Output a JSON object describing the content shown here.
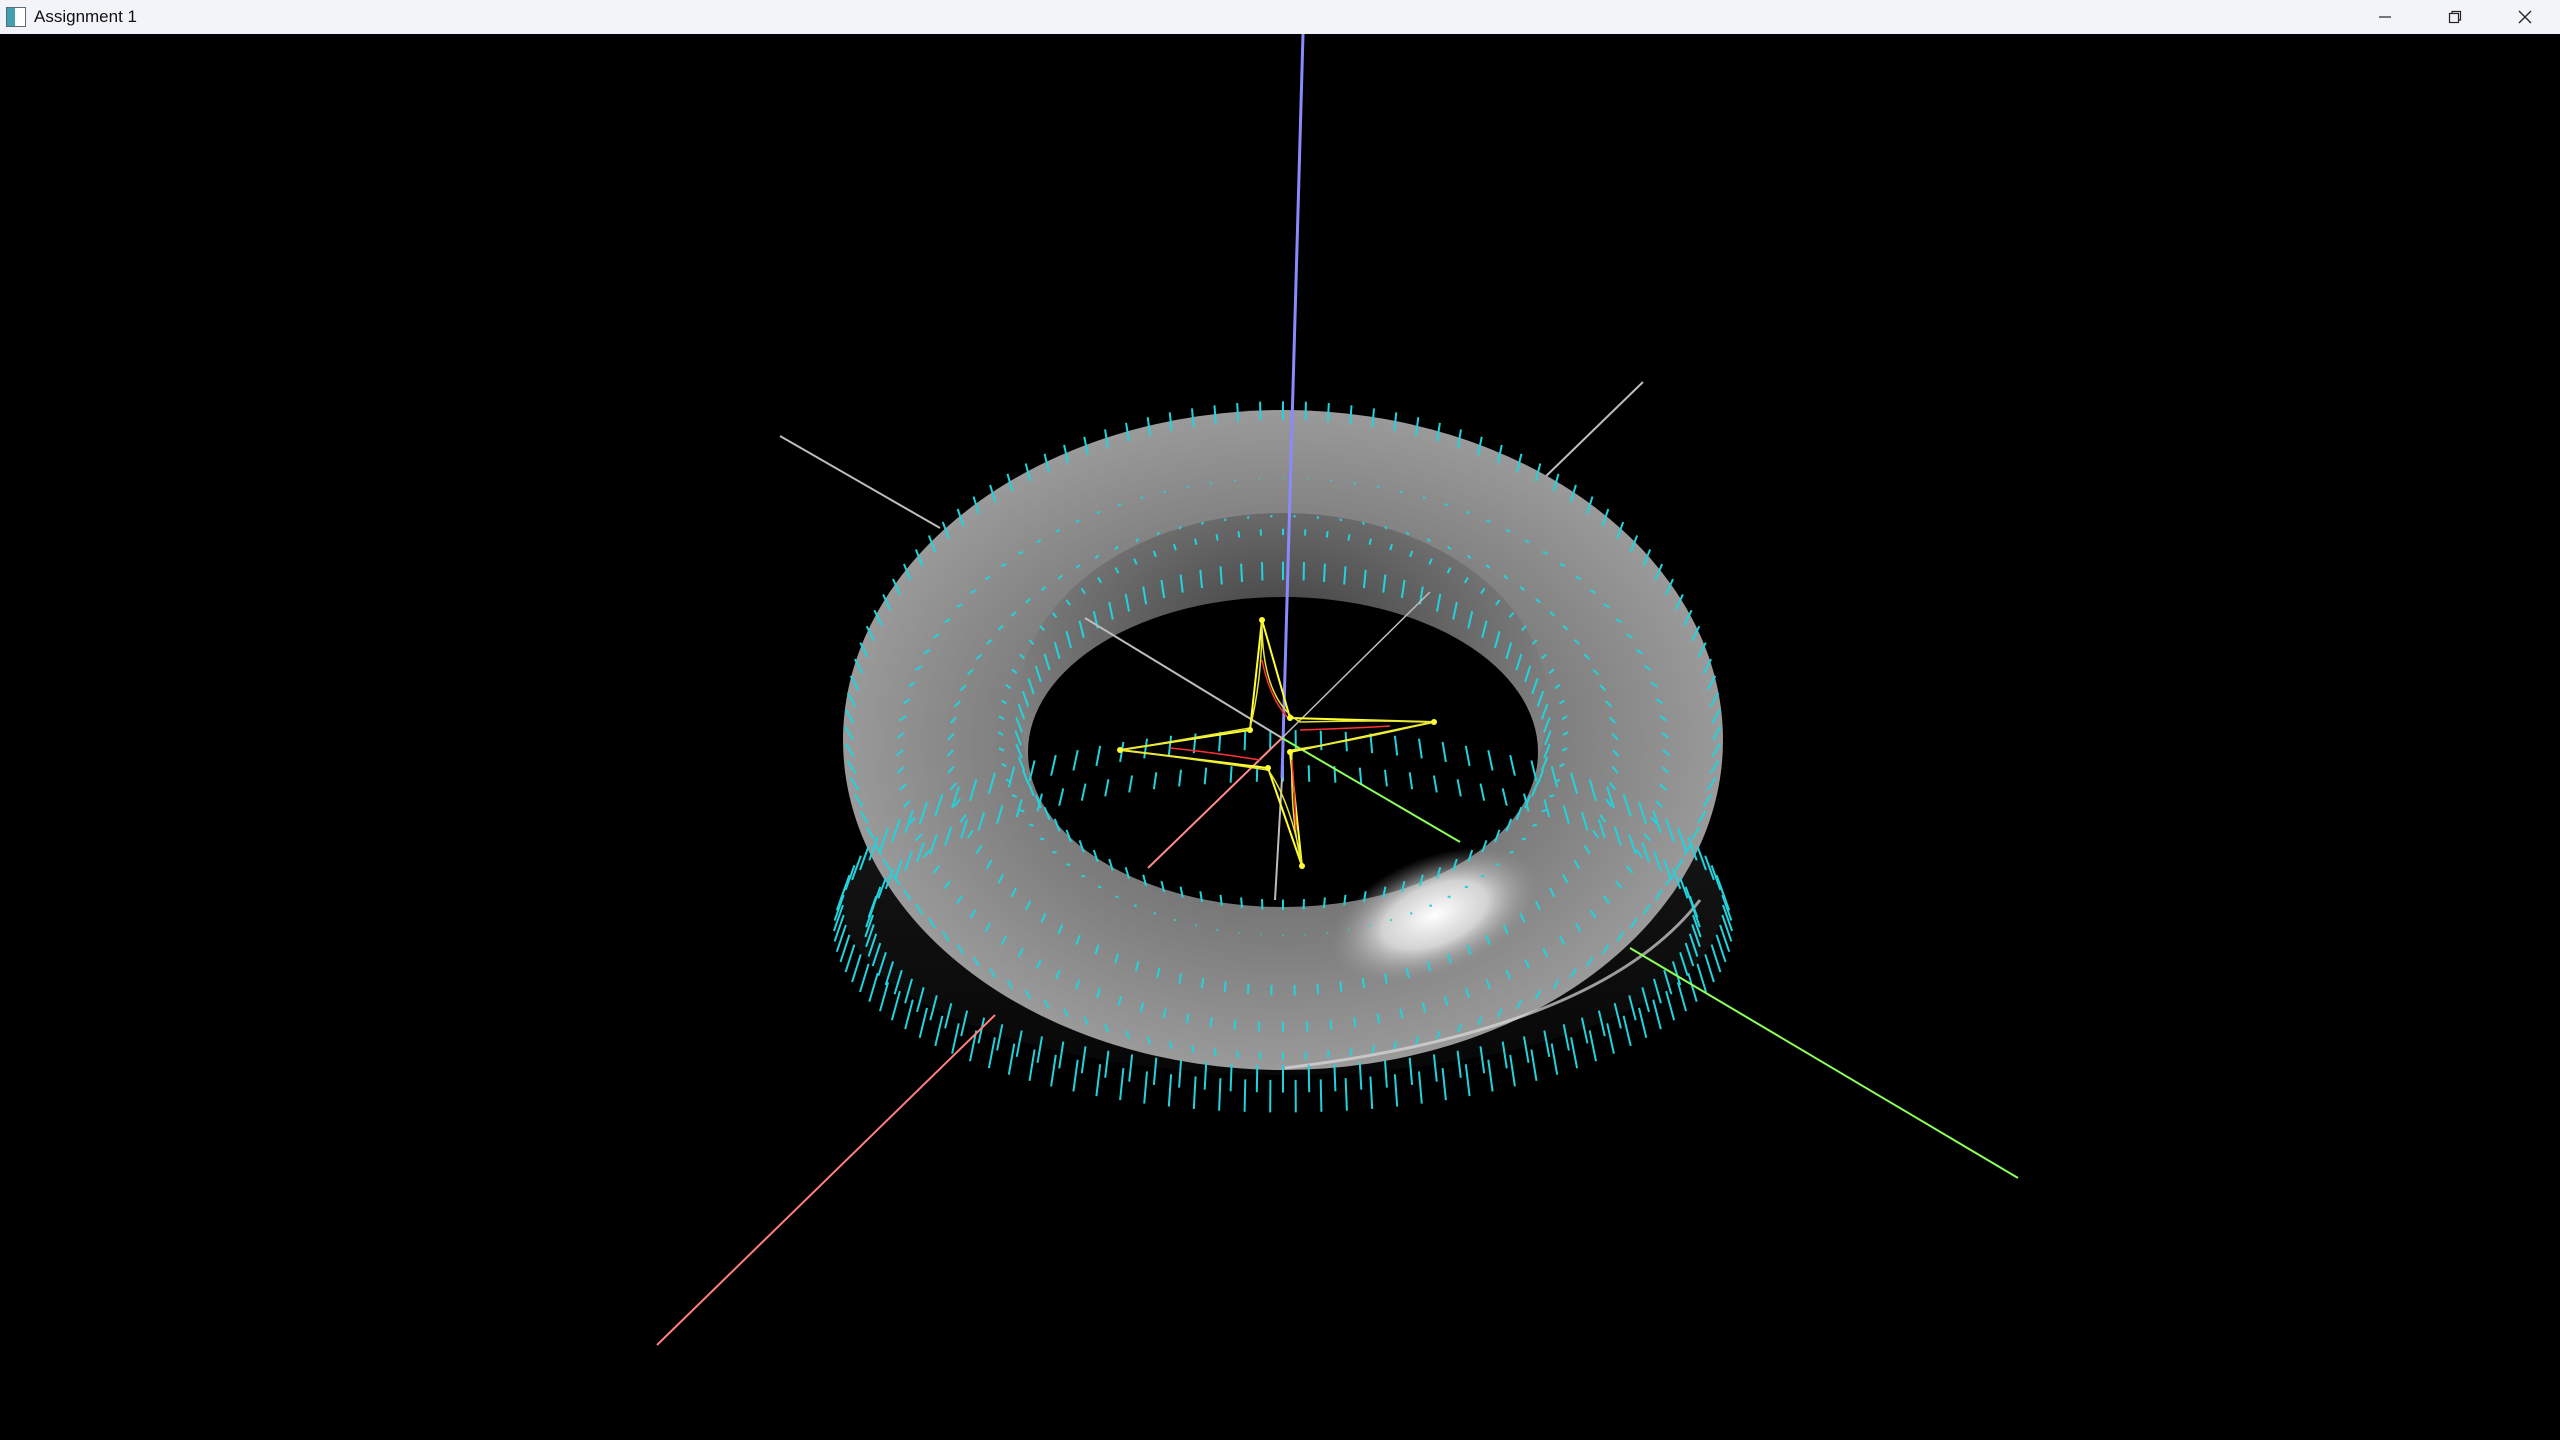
{
  "window": {
    "title": "Assignment 1",
    "icon": "opengl-window-icon",
    "controls": {
      "minimize": "minimize-icon",
      "restore": "restore-icon",
      "close": "close-icon"
    }
  },
  "scene": {
    "background": "#000000",
    "objects": [
      "torus",
      "normal-vectors",
      "star-curve",
      "control-polygon",
      "x-axis",
      "y-axis",
      "z-axis",
      "grid-lines"
    ],
    "colors": {
      "torus": "#8a8a8a",
      "normals": "#22d3dd",
      "x_axis": "#ff7f7f",
      "y_axis": "#8cff5a",
      "z_axis": "#8a8aff",
      "grid": "#bdbdbd",
      "control_polygon": "#ffff33",
      "curve": "#ff3333"
    }
  }
}
